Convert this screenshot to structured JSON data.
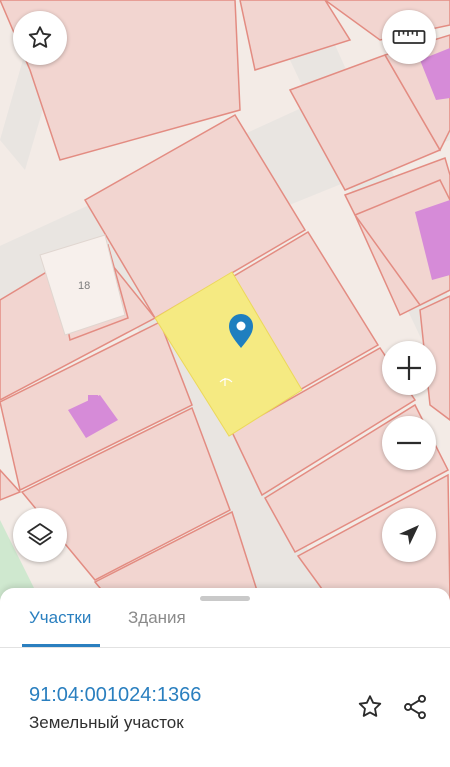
{
  "map": {
    "labels": [
      "18"
    ],
    "colors": {
      "background": "#f3ebe6",
      "road": "#e9e5e1",
      "parcel_fill": "#f2d5d0",
      "parcel_border": "#e38c82",
      "building": "#d68bd8",
      "selected_parcel": "#f5ea82",
      "marker": "#1e7fbf",
      "green_area": "#cfe8cf"
    },
    "selected_marker_icon": "location-pin-icon"
  },
  "controls": {
    "favorite": "star-outline-icon",
    "ruler": "ruler-icon",
    "zoom_in": "plus-icon",
    "zoom_out": "minus-icon",
    "layers": "layers-icon",
    "navigate": "navigation-arrow-icon"
  },
  "sheet": {
    "tabs": [
      {
        "label": "Участки",
        "active": true
      },
      {
        "label": "Здания",
        "active": false
      }
    ],
    "result": {
      "cadastral_number": "91:04:001024:1366",
      "type": "Земельный участок"
    },
    "actions": [
      "star-outline-icon",
      "share-icon"
    ],
    "accent": "#2a7fbf"
  }
}
